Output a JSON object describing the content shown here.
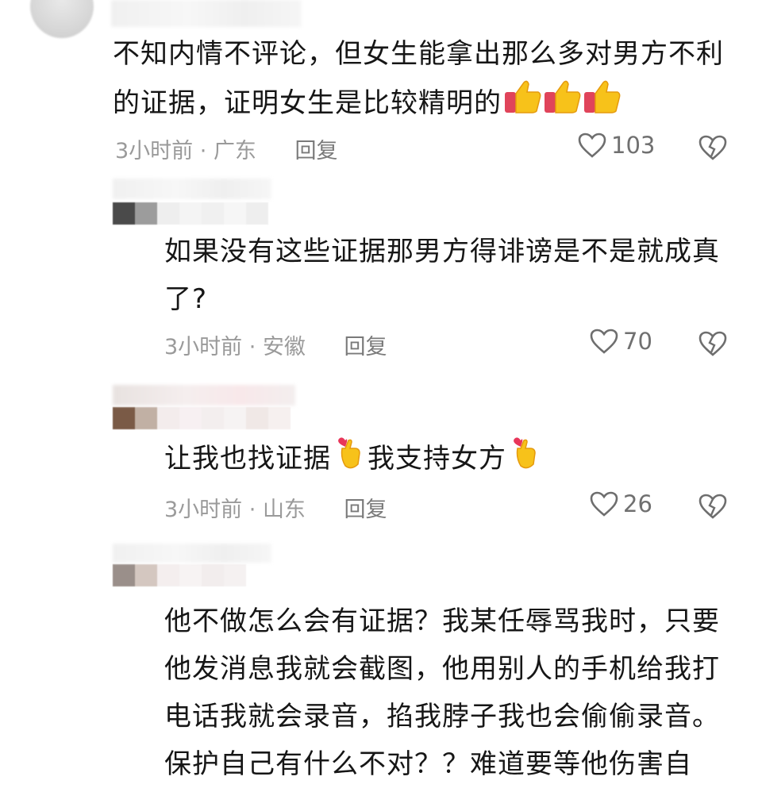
{
  "comments": [
    {
      "text_lines": [
        "不知内情不评论，但女生能拿出那么多对男方不利",
        "的证据，证明女生是比较精明的"
      ],
      "time": "3小时前",
      "location": "广东",
      "reply_label": "回复",
      "likes": "103",
      "emoji": "thumbs-up",
      "emoji_count": 3
    },
    {
      "text_lines": [
        "如果没有这些证据那男方得诽谤是不是就成真",
        "了?"
      ],
      "time": "3小时前",
      "location": "安徽",
      "reply_label": "回复",
      "likes": "70"
    },
    {
      "text_a": "让我也找证据",
      "text_b": "我支持女方",
      "emoji": "finger-heart",
      "time": "3小时前",
      "location": "山东",
      "reply_label": "回复",
      "likes": "26"
    },
    {
      "text_lines": [
        "他不做怎么会有证据？我某任辱骂我时，只要",
        "他发消息我就会截图，他用别人的手机给我打",
        "电话我就会录音，掐我脖子我也会偷偷录音。",
        "保护自己有什么不对？？难道要等他伤害自"
      ]
    }
  ],
  "meta_separator": " · "
}
